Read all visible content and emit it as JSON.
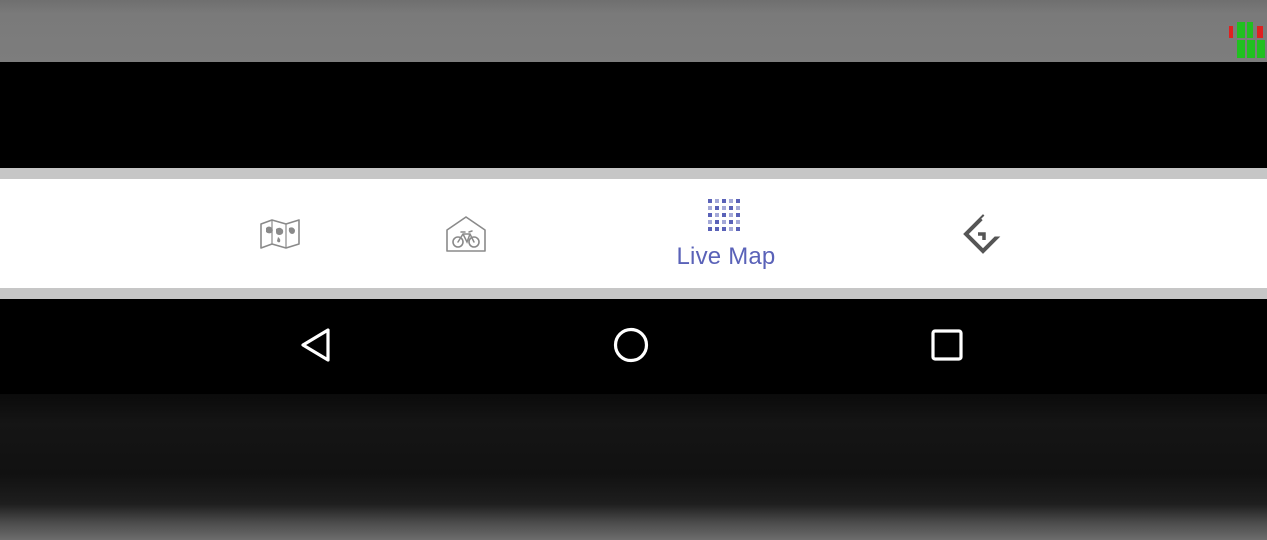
{
  "bottom_nav": {
    "items": [
      {
        "icon": "world-map-icon",
        "label": "",
        "active": false
      },
      {
        "icon": "bike-station-icon",
        "label": "",
        "active": false
      },
      {
        "icon": "live-map-icon",
        "label": "Live Map",
        "active": true
      },
      {
        "icon": "navigation-diamond-icon",
        "label": "",
        "active": false
      }
    ],
    "active_color": "#5a62b8",
    "inactive_color": "#8a8a8a"
  },
  "system_nav": {
    "items": [
      {
        "icon": "back-triangle-icon"
      },
      {
        "icon": "home-circle-icon"
      },
      {
        "icon": "recents-square-icon"
      }
    ]
  },
  "status_indicator": {
    "icon": "signal-bars-icon",
    "colors": [
      "#e02020",
      "#20c020"
    ]
  }
}
